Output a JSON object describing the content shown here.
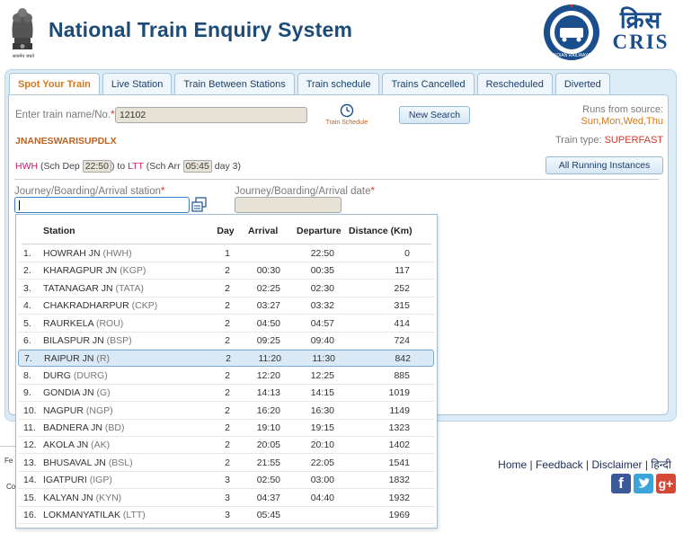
{
  "header": {
    "title": "National Train Enquiry System",
    "emblem_caption": "सत्यमेव जयते",
    "cris_label": "CRIS",
    "cris_hindi": "क्रिस",
    "ir_label": "INDIAN RAILWAYS"
  },
  "tabs": [
    {
      "label": "Spot Your Train",
      "active": true
    },
    {
      "label": "Live Station"
    },
    {
      "label": "Train Between Stations"
    },
    {
      "label": "Train schedule"
    },
    {
      "label": "Trains Cancelled"
    },
    {
      "label": "Rescheduled"
    },
    {
      "label": "Diverted"
    }
  ],
  "form": {
    "train_label": "Enter train name/No.",
    "train_value": "12102",
    "schedule_label": "Train Schedule",
    "new_search": "New Search",
    "runs_label": "Runs from source:",
    "runs_days": "Sun,Mon,Wed,Thu",
    "train_name": "JNANESWARISUPDLX",
    "train_type_label": "Train type:",
    "train_type": "SUPERFAST",
    "route_from": "HWH",
    "route_sch_dep": "(Sch Dep",
    "dep_time": "22:50",
    "route_to_word": ") to",
    "route_to": "LTT",
    "route_sch_arr": "(Sch Arr",
    "arr_time": "05:45",
    "arr_day": "day 3)",
    "all_running": "All Running Instances",
    "station_label": "Journey/Boarding/Arrival station",
    "date_label": "Journey/Boarding/Arrival date",
    "required_mark": "*"
  },
  "table": {
    "headers": {
      "station": "Station",
      "day": "Day",
      "arrival": "Arrival",
      "departure": "Departure",
      "distance": "Distance (Km)"
    },
    "selected_index": 6,
    "rows": [
      {
        "no": "1.",
        "name": "HOWRAH JN",
        "code": "(HWH)",
        "day": "1",
        "arr": "",
        "dep": "22:50",
        "dist": "0"
      },
      {
        "no": "2.",
        "name": "KHARAGPUR JN",
        "code": "(KGP)",
        "day": "2",
        "arr": "00:30",
        "dep": "00:35",
        "dist": "117"
      },
      {
        "no": "3.",
        "name": "TATANAGAR JN",
        "code": "(TATA)",
        "day": "2",
        "arr": "02:25",
        "dep": "02:30",
        "dist": "252"
      },
      {
        "no": "4.",
        "name": "CHAKRADHARPUR",
        "code": "(CKP)",
        "day": "2",
        "arr": "03:27",
        "dep": "03:32",
        "dist": "315"
      },
      {
        "no": "5.",
        "name": "RAURKELA",
        "code": "(ROU)",
        "day": "2",
        "arr": "04:50",
        "dep": "04:57",
        "dist": "414"
      },
      {
        "no": "6.",
        "name": "BILASPUR JN",
        "code": "(BSP)",
        "day": "2",
        "arr": "09:25",
        "dep": "09:40",
        "dist": "724"
      },
      {
        "no": "7.",
        "name": "RAIPUR JN",
        "code": "(R)",
        "day": "2",
        "arr": "11:20",
        "dep": "11:30",
        "dist": "842"
      },
      {
        "no": "8.",
        "name": "DURG",
        "code": "(DURG)",
        "day": "2",
        "arr": "12:20",
        "dep": "12:25",
        "dist": "885"
      },
      {
        "no": "9.",
        "name": "GONDIA JN",
        "code": "(G)",
        "day": "2",
        "arr": "14:13",
        "dep": "14:15",
        "dist": "1019"
      },
      {
        "no": "10.",
        "name": "NAGPUR",
        "code": "(NGP)",
        "day": "2",
        "arr": "16:20",
        "dep": "16:30",
        "dist": "1149"
      },
      {
        "no": "11.",
        "name": "BADNERA JN",
        "code": "(BD)",
        "day": "2",
        "arr": "19:10",
        "dep": "19:15",
        "dist": "1323"
      },
      {
        "no": "12.",
        "name": "AKOLA JN",
        "code": "(AK)",
        "day": "2",
        "arr": "20:05",
        "dep": "20:10",
        "dist": "1402"
      },
      {
        "no": "13.",
        "name": "BHUSAVAL JN",
        "code": "(BSL)",
        "day": "2",
        "arr": "21:55",
        "dep": "22:05",
        "dist": "1541"
      },
      {
        "no": "14.",
        "name": "IGATPURI",
        "code": "(IGP)",
        "day": "3",
        "arr": "02:50",
        "dep": "03:00",
        "dist": "1832"
      },
      {
        "no": "15.",
        "name": "KALYAN JN",
        "code": "(KYN)",
        "day": "3",
        "arr": "04:37",
        "dep": "04:40",
        "dist": "1932"
      },
      {
        "no": "16.",
        "name": "LOKMANYATILAK",
        "code": "(LTT)",
        "day": "3",
        "arr": "05:45",
        "dep": "",
        "dist": "1969"
      }
    ]
  },
  "footer": {
    "links": [
      "Home",
      "Feedback",
      "Disclaimer",
      "हिन्दी"
    ],
    "separator": "|",
    "left_fragment_1": "Fe",
    "left_fragment_2": "Co"
  },
  "colors": {
    "title": "#1c4b78",
    "active_tab": "#d4771a",
    "route_station": "#c41d6a",
    "facebook": "#3b5998",
    "twitter": "#3ba4d9",
    "googleplus": "#d34836"
  }
}
